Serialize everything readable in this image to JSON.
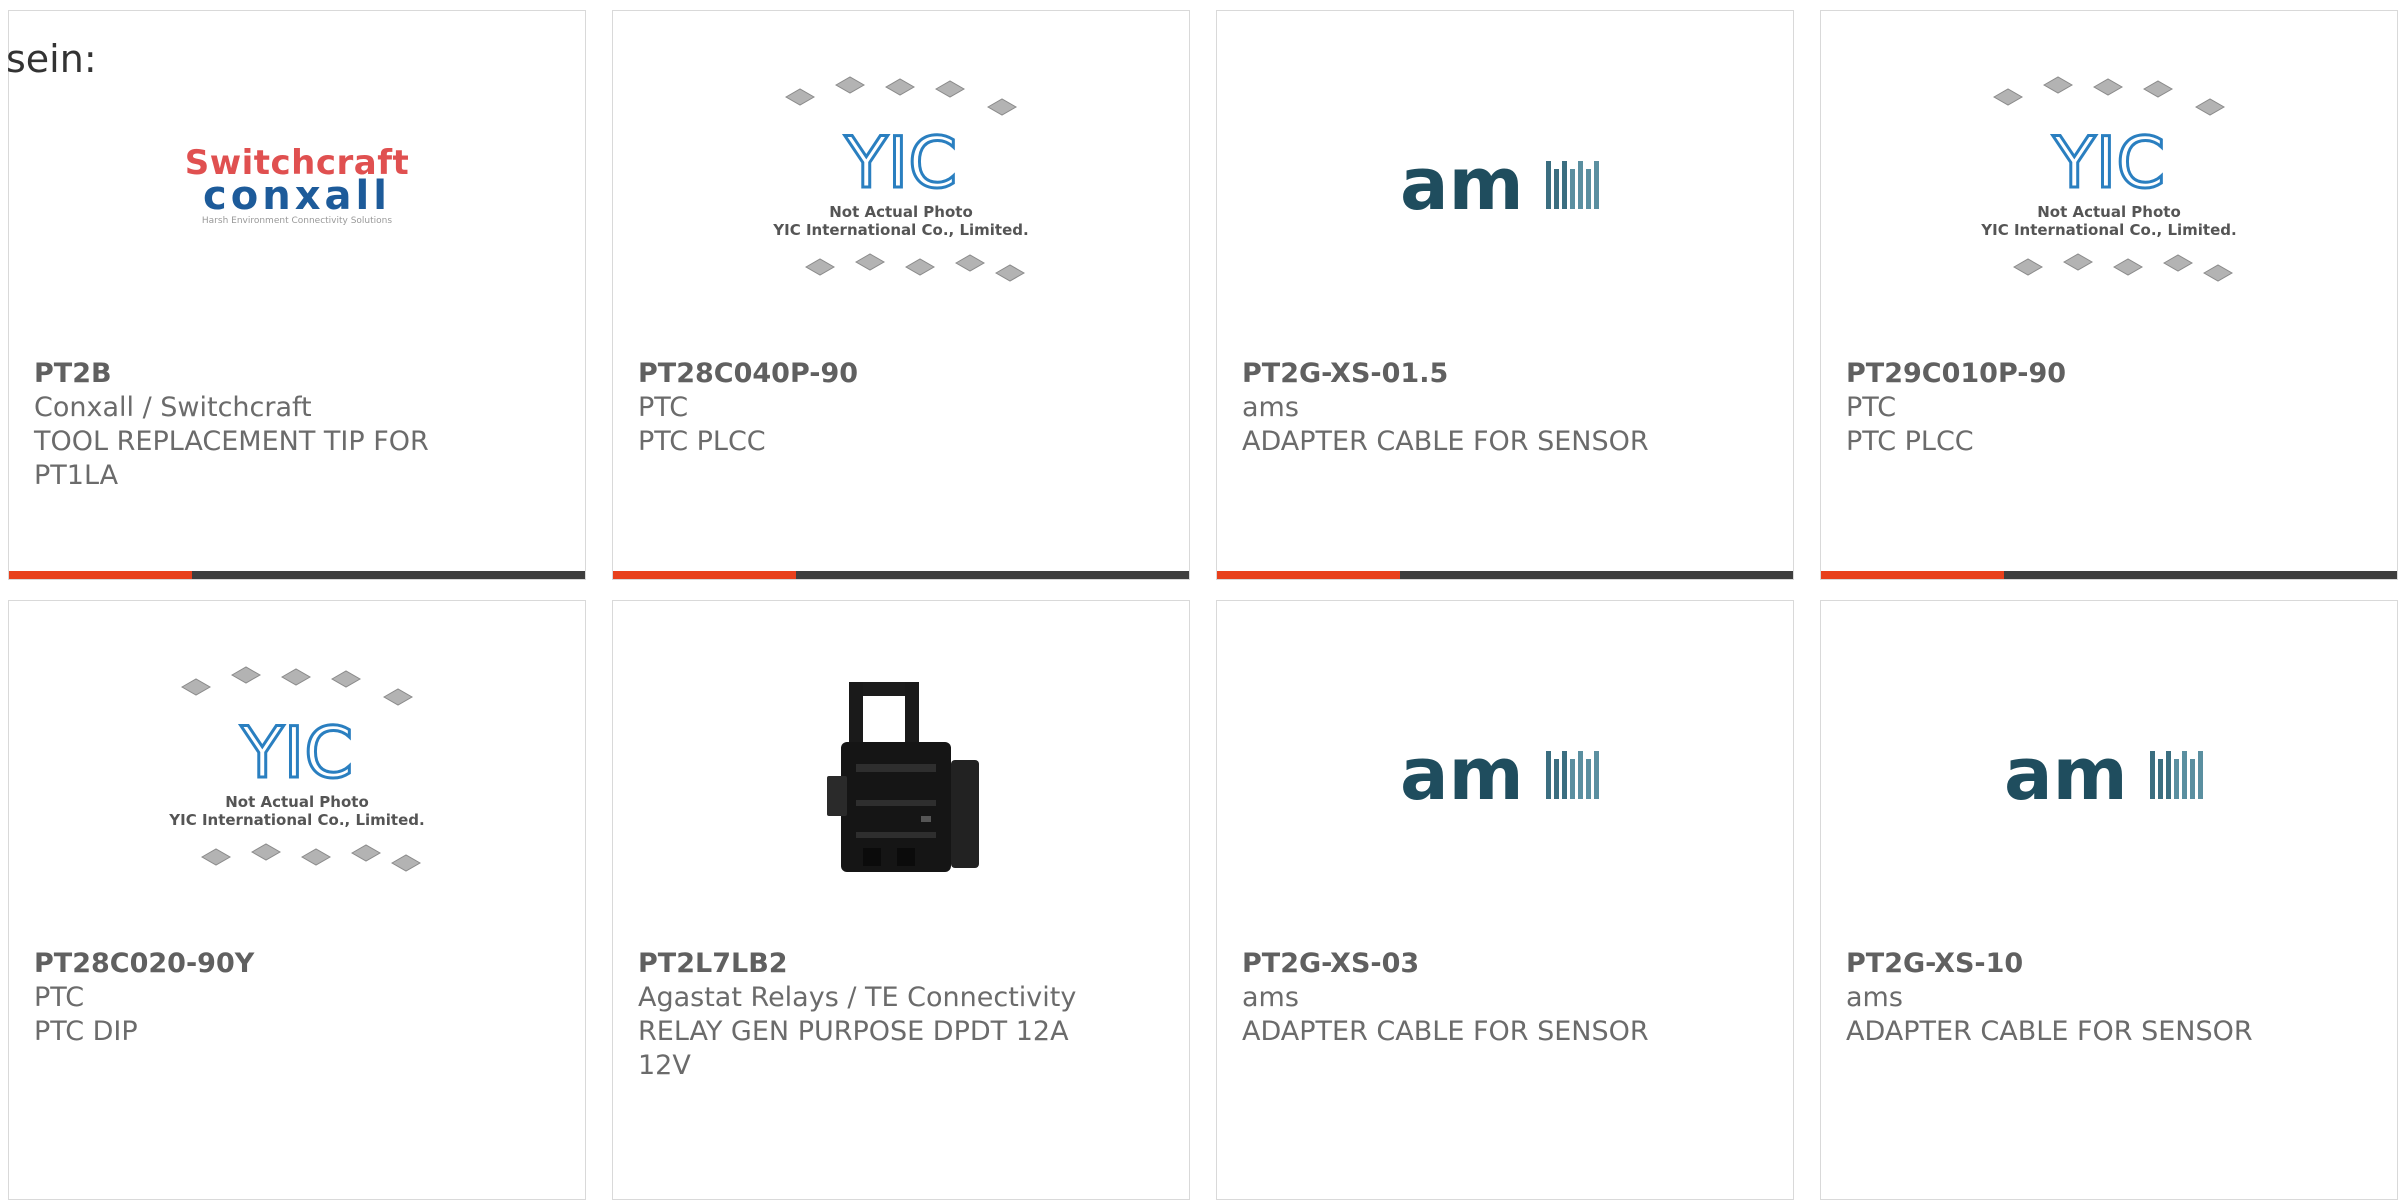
{
  "heading": "sein:",
  "accent_color": "#e8401c",
  "bar_color": "#3e3e3e",
  "cards": [
    {
      "part": "PT2B",
      "maker": "Conxall / Switchcraft",
      "desc": "TOOL REPLACEMENT TIP FOR\nPT1LA",
      "image": "switchcraft-conxall-logo",
      "logo": {
        "l1": "Switchcraft",
        "l2": "conxall",
        "l3": "Harsh Environment Connectivity Solutions"
      }
    },
    {
      "part": "PT28C040P-90",
      "maker": "PTC",
      "desc": "PTC PLCC",
      "image": "yic-not-actual-photo",
      "logo": {
        "cap1": "Not Actual Photo",
        "cap2": "YIC International Co., Limited."
      }
    },
    {
      "part": "PT2G-XS-01.5",
      "maker": "ams",
      "desc": "ADAPTER CABLE FOR SENSOR",
      "image": "ams-logo"
    },
    {
      "part": "PT29C010P-90",
      "maker": "PTC",
      "desc": "PTC PLCC",
      "image": "yic-not-actual-photo",
      "logo": {
        "cap1": "Not Actual Photo",
        "cap2": "YIC International Co., Limited."
      }
    },
    {
      "part": "PT28C020-90Y",
      "maker": "PTC",
      "desc": "PTC DIP",
      "image": "yic-not-actual-photo",
      "logo": {
        "cap1": "Not Actual Photo",
        "cap2": "YIC International Co., Limited."
      }
    },
    {
      "part": "PT2L7LB2",
      "maker": "Agastat Relays / TE Connectivity",
      "desc": "RELAY GEN PURPOSE DPDT 12A\n12V",
      "image": "relay-socket-photo"
    },
    {
      "part": "PT2G-XS-03",
      "maker": "ams",
      "desc": "ADAPTER CABLE FOR SENSOR",
      "image": "ams-logo"
    },
    {
      "part": "PT2G-XS-10",
      "maker": "ams",
      "desc": "ADAPTER CABLE FOR SENSOR",
      "image": "ams-logo"
    }
  ]
}
